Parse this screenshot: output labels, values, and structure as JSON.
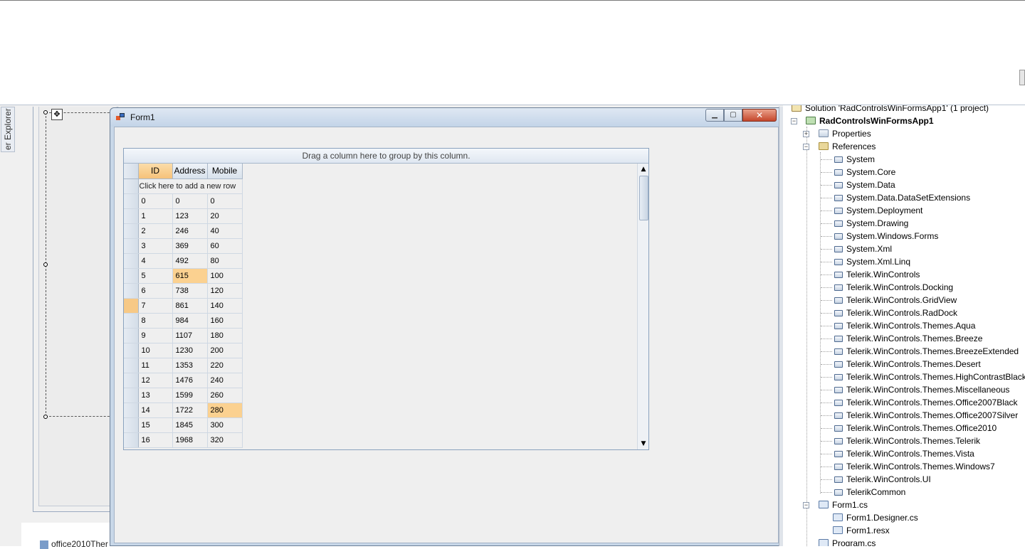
{
  "designer": {
    "side_tab_label": "er Explorer",
    "move_glyph": "✥",
    "bottom_file_label": "office2010Ther"
  },
  "form": {
    "title": "Form1",
    "icon": "form-icon",
    "buttons": {
      "minimize": "▁",
      "maximize": "▢",
      "close": "✕"
    }
  },
  "grid": {
    "group_panel_text": "Drag a column here to group by this column.",
    "columns": [
      "ID",
      "Address",
      "Mobile"
    ],
    "new_row_text": "Click here to add a new row",
    "rows": [
      [
        "0",
        "0",
        "0"
      ],
      [
        "1",
        "123",
        "20"
      ],
      [
        "2",
        "246",
        "40"
      ],
      [
        "3",
        "369",
        "60"
      ],
      [
        "4",
        "492",
        "80"
      ],
      [
        "5",
        "615",
        "100"
      ],
      [
        "6",
        "738",
        "120"
      ],
      [
        "7",
        "861",
        "140"
      ],
      [
        "8",
        "984",
        "160"
      ],
      [
        "9",
        "1107",
        "180"
      ],
      [
        "10",
        "1230",
        "200"
      ],
      [
        "11",
        "1353",
        "220"
      ],
      [
        "12",
        "1476",
        "240"
      ],
      [
        "13",
        "1599",
        "260"
      ],
      [
        "14",
        "1722",
        "280"
      ],
      [
        "15",
        "1845",
        "300"
      ],
      [
        "16",
        "1968",
        "320"
      ]
    ],
    "scroll_up": "▲",
    "scroll_down": "▼"
  },
  "solution_explorer": {
    "solution_label": "Solution 'RadControlsWinFormsApp1' (1 project)",
    "project_label": "RadControlsWinFormsApp1",
    "properties_label": "Properties",
    "references_label": "References",
    "references": [
      "System",
      "System.Core",
      "System.Data",
      "System.Data.DataSetExtensions",
      "System.Deployment",
      "System.Drawing",
      "System.Windows.Forms",
      "System.Xml",
      "System.Xml.Linq",
      "Telerik.WinControls",
      "Telerik.WinControls.Docking",
      "Telerik.WinControls.GridView",
      "Telerik.WinControls.RadDock",
      "Telerik.WinControls.Themes.Aqua",
      "Telerik.WinControls.Themes.Breeze",
      "Telerik.WinControls.Themes.BreezeExtended",
      "Telerik.WinControls.Themes.Desert",
      "Telerik.WinControls.Themes.HighContrastBlack",
      "Telerik.WinControls.Themes.Miscellaneous",
      "Telerik.WinControls.Themes.Office2007Black",
      "Telerik.WinControls.Themes.Office2007Silver",
      "Telerik.WinControls.Themes.Office2010",
      "Telerik.WinControls.Themes.Telerik",
      "Telerik.WinControls.Themes.Vista",
      "Telerik.WinControls.Themes.Windows7",
      "Telerik.WinControls.UI",
      "TelerikCommon"
    ],
    "form1_label": "Form1.cs",
    "form1_children": [
      "Form1.Designer.cs",
      "Form1.resx"
    ],
    "program_label": "Program.cs"
  },
  "colors": {
    "highlight": "#fbd190",
    "sorted_header": "#f6c27a",
    "close_button": "#c5472c"
  }
}
